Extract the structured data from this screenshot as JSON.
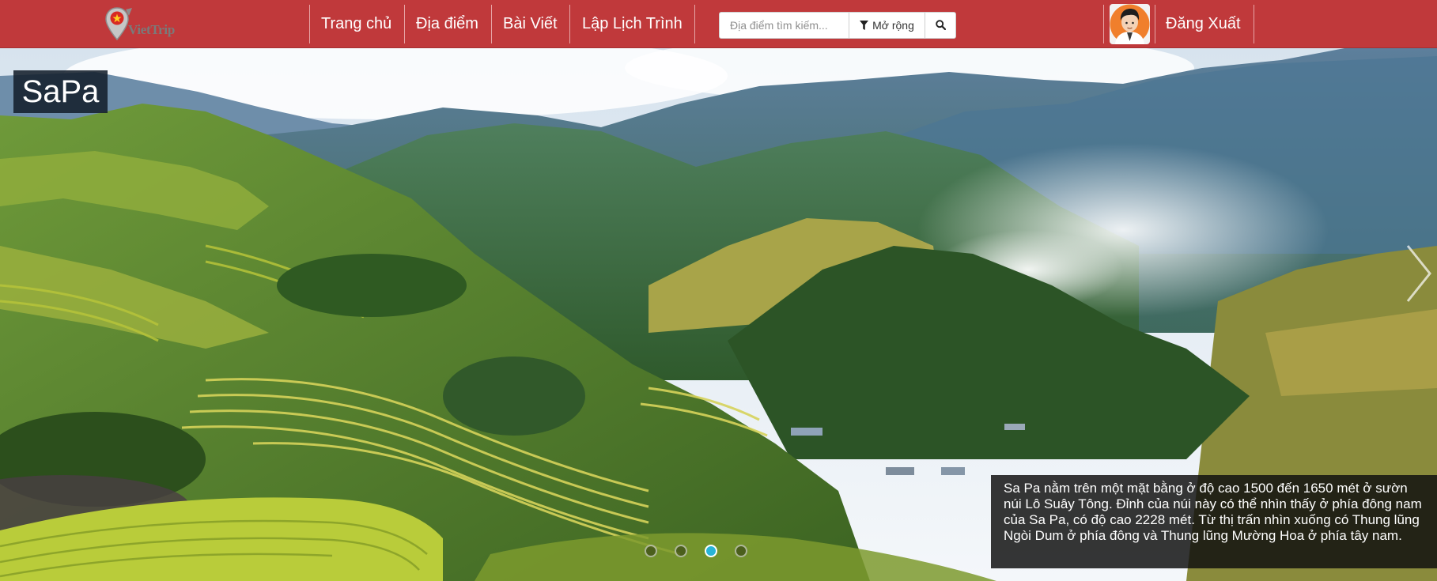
{
  "brand": {
    "logo_text": "VietTrip"
  },
  "nav": {
    "items": [
      {
        "label": "Trang chủ"
      },
      {
        "label": "Địa điểm"
      },
      {
        "label": "Bài Viết"
      },
      {
        "label": "Lập Lịch Trình"
      }
    ],
    "logout_label": "Đăng Xuất"
  },
  "search": {
    "placeholder": "Địa điểm tìm kiếm...",
    "expand_label": "Mở rộng"
  },
  "slider": {
    "title": "SaPa",
    "description": "Sa Pa nằm trên một mặt bằng ở độ cao 1500 đến 1650 mét ở sườn núi Lô Suây Tông. Đỉnh của núi này có thể nhìn thấy ở phía đông nam của Sa Pa, có độ cao 2228 mét. Từ thị trấn nhìn xuống có Thung lũng Ngòi Dum ở phía đông và Thung lũng Mường Hoa ở phía tây nam.",
    "indicator_count": 4,
    "active_index": 2
  },
  "icons": {
    "logo": "map-pin-icon",
    "expand": "filter-icon",
    "search": "search-icon",
    "next": "chevron-right-icon"
  },
  "colors": {
    "navbar": "#c0393b",
    "active_dot": "#29b4d6"
  }
}
